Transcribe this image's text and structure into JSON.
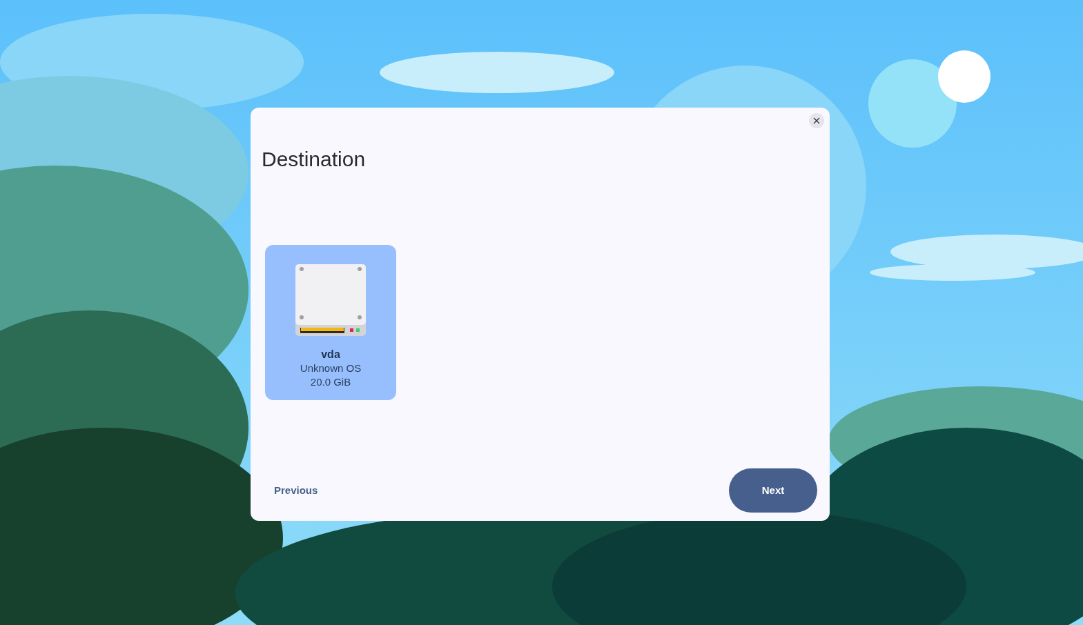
{
  "dialog": {
    "title": "Destination",
    "disks": [
      {
        "name": "vda",
        "os": "Unknown OS",
        "size": "20.0 GiB",
        "selected": true
      }
    ],
    "previous_button": "Previous",
    "next_button": "Next"
  }
}
